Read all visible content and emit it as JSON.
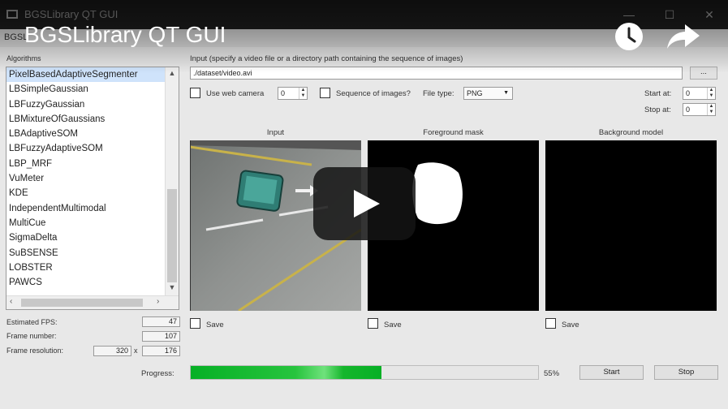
{
  "overlay": {
    "video_title": "BGSLibrary QT GUI"
  },
  "window": {
    "title": "BGSLibrary QT GUI",
    "menu_text": "BGSL"
  },
  "sidebar": {
    "algorithms_label": "Algorithms",
    "items": [
      "PixelBasedAdaptiveSegmenter",
      "LBSimpleGaussian",
      "LBFuzzyGaussian",
      "LBMixtureOfGaussians",
      "LBAdaptiveSOM",
      "LBFuzzyAdaptiveSOM",
      "LBP_MRF",
      "VuMeter",
      "KDE",
      "IndependentMultimodal",
      "MultiCue",
      "SigmaDelta",
      "SuBSENSE",
      "LOBSTER",
      "PAWCS"
    ],
    "selected_index": 0
  },
  "stats": {
    "fps_label": "Estimated FPS:",
    "fps_value": "47",
    "frame_number_label": "Frame number:",
    "frame_number_value": "107",
    "resolution_label": "Frame resolution:",
    "resolution_width": "320",
    "resolution_x": "x",
    "resolution_height": "176"
  },
  "input": {
    "label": "Input (specify a video file or a directory path containing the sequence of images)",
    "path_value": "./dataset/video.avi",
    "browse_label": "...",
    "webcam_label": "Use web camera",
    "webcam_index": "0",
    "sequence_label": "Sequence of images?",
    "file_type_label": "File type:",
    "file_type_value": "PNG",
    "start_at_label": "Start at:",
    "start_at_value": "0",
    "stop_at_label": "Stop at:",
    "stop_at_value": "0"
  },
  "views": [
    {
      "title": "Input",
      "save_label": "Save"
    },
    {
      "title": "Foreground mask",
      "save_label": "Save"
    },
    {
      "title": "Background model",
      "save_label": "Save"
    }
  ],
  "progress": {
    "label": "Progress:",
    "fraction": 0.55,
    "percent_text": "55%",
    "start_label": "Start",
    "stop_label": "Stop"
  },
  "colors": {
    "progress_green": "#06b025",
    "selection": "#cfe3fb",
    "window_bg": "#e8e8e8"
  }
}
